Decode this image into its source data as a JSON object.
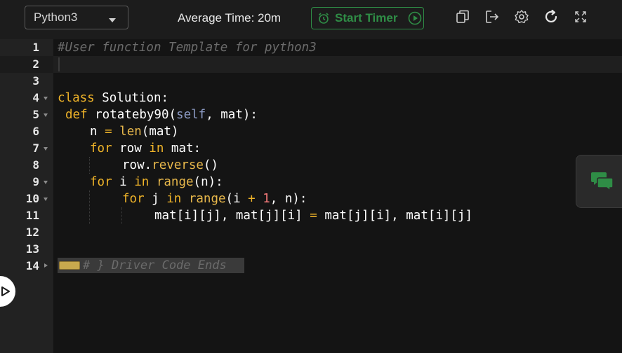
{
  "toolbar": {
    "language": "Python3",
    "average_time": "Average Time: 20m",
    "timer_label": "Start Timer",
    "icons": [
      "copy-icon",
      "export-icon",
      "settings-icon",
      "reset-icon",
      "fullscreen-icon"
    ],
    "accent_color": "#2f8d46"
  },
  "editor": {
    "line_numbers": [
      "1",
      "2",
      "3",
      "4",
      "5",
      "6",
      "7",
      "8",
      "9",
      "10",
      "11",
      "12",
      "13",
      "14"
    ],
    "line1": "#User function Template for python3",
    "line4": {
      "kw": "class",
      "rest": " Solution:"
    },
    "line5": {
      "kw": "def",
      "name": " rotateby90(",
      "self": "self",
      "rest": ", mat):"
    },
    "line6": {
      "lhs": "n ",
      "op": "=",
      "sp": " ",
      "builtin": "len",
      "rest": "(mat)"
    },
    "line7": {
      "kw1": "for",
      "mid": " row ",
      "kw2": "in",
      "rest": " mat:"
    },
    "line8": {
      "obj": "row.",
      "method": "reverse",
      "rest": "()"
    },
    "line9": {
      "kw1": "for",
      "mid": " i ",
      "kw2": "in",
      "sp": " ",
      "builtin": "range",
      "rest": "(n):"
    },
    "line10": {
      "kw1": "for",
      "mid": " j ",
      "kw2": "in",
      "sp": " ",
      "builtin": "range",
      "a": "(i ",
      "op": "+",
      "sp2": " ",
      "num": "1",
      "rest": ", n):"
    },
    "line11": {
      "lhs": "mat[i][j], mat[j][i] ",
      "op": "=",
      "rest": " mat[j][i], mat[i][j]"
    },
    "folded_text": "# } Driver Code Ends"
  }
}
